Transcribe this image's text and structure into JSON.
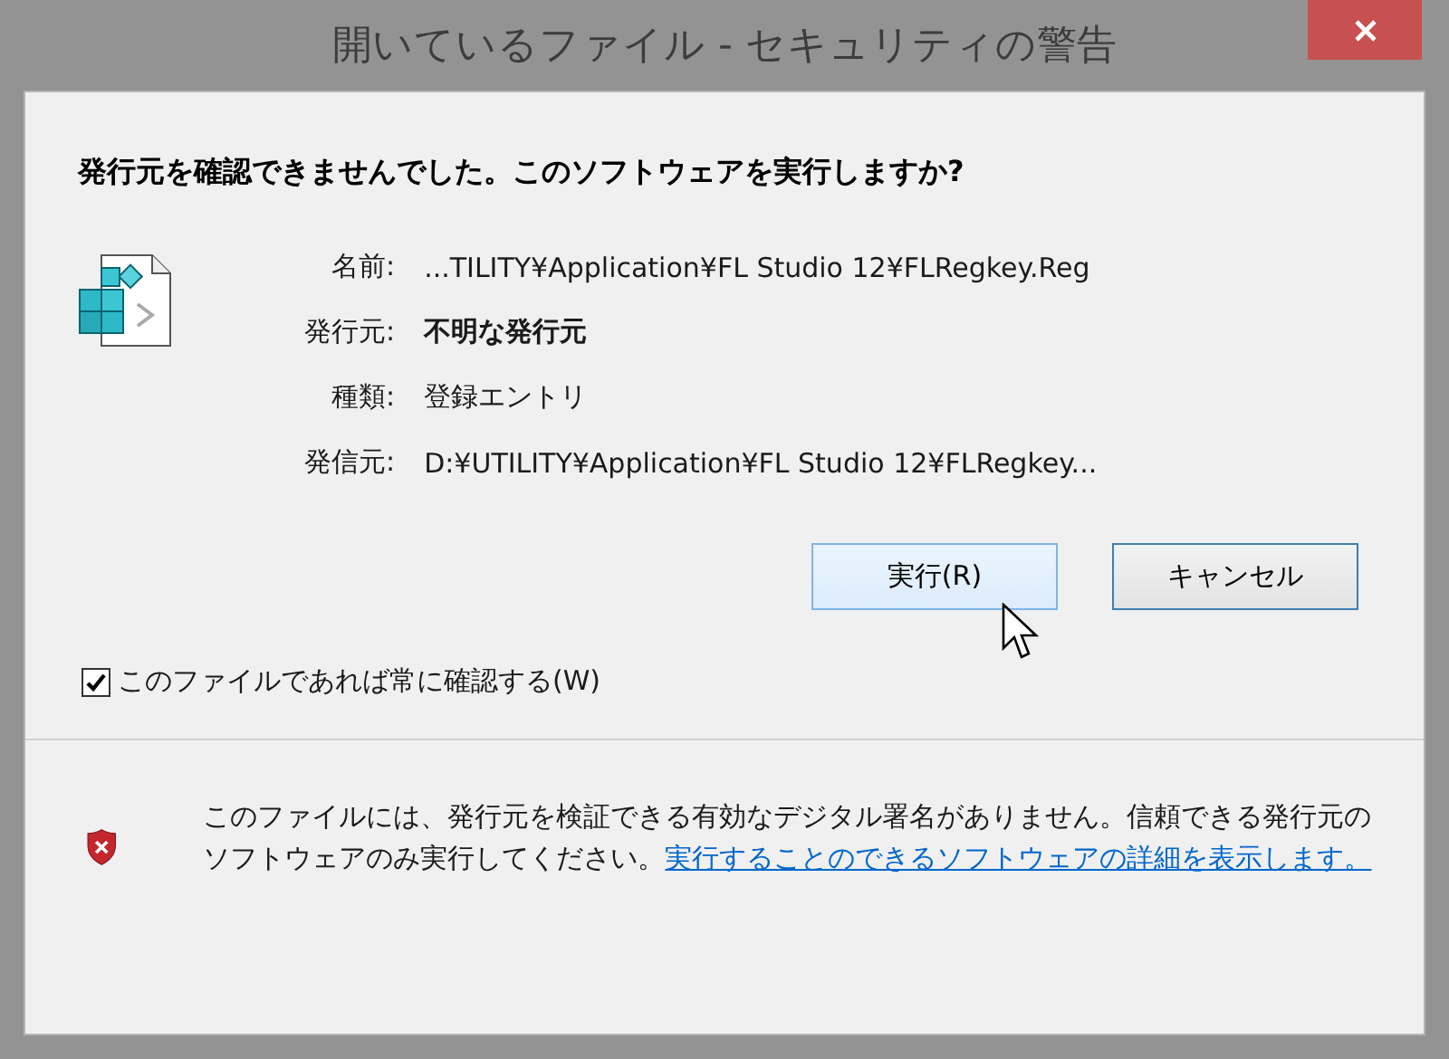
{
  "window": {
    "title": "開いているファイル - セキュリティの警告"
  },
  "headline": "発行元を確認できませんでした。このソフトウェアを実行しますか?",
  "fields": [
    {
      "label": "名前:",
      "value": "...TILITY¥Application¥FL Studio 12¥FLRegkey.Reg",
      "bold": false
    },
    {
      "label": "発行元:",
      "value": "不明な発行元",
      "bold": true
    },
    {
      "label": "種類:",
      "value": "登録エントリ",
      "bold": false
    },
    {
      "label": "発信元:",
      "value": "D:¥UTILITY¥Application¥FL Studio 12¥FLRegkey...",
      "bold": false
    }
  ],
  "buttons": [
    {
      "label": "実行(R)",
      "hovered": true
    },
    {
      "label": "キャンセル",
      "hovered": false
    }
  ],
  "checkbox": {
    "label": "このファイルであれば常に確認する(W)",
    "checked": true
  },
  "footer": {
    "text": "このファイルには、発行元を検証できる有効なデジタル署名がありません。信頼できる発行元のソフトウェアのみ実行してください。",
    "link": "実行することのできるソフトウェアの詳細を表示します。"
  }
}
